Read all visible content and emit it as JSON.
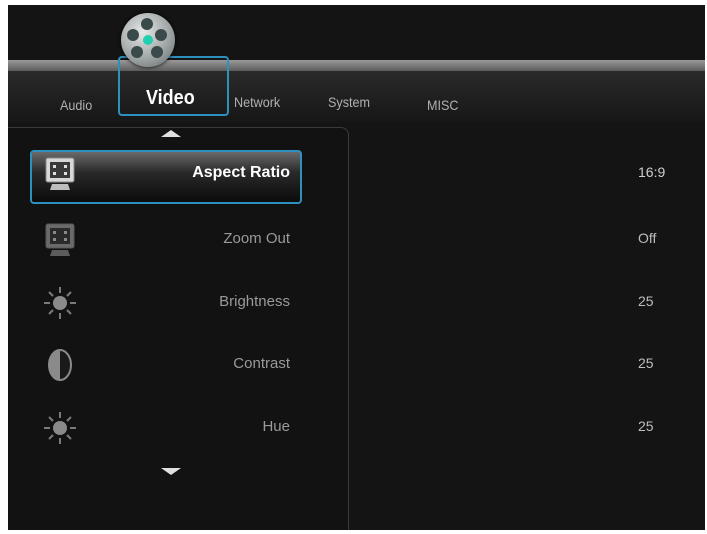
{
  "tabs": [
    {
      "label": "Audio",
      "active": false
    },
    {
      "label": "Video",
      "active": true
    },
    {
      "label": "Network",
      "active": false
    },
    {
      "label": "System",
      "active": false
    },
    {
      "label": "MISC",
      "active": false
    }
  ],
  "colors": {
    "accent": "#2f8fbf",
    "background": "#141414"
  },
  "menu": {
    "items": [
      {
        "label": "Aspect Ratio",
        "value": "16:9",
        "icon": "monitor-icon",
        "selected": true
      },
      {
        "label": "Zoom Out",
        "value": "Off",
        "icon": "monitor-icon",
        "selected": false
      },
      {
        "label": "Brightness",
        "value": "25",
        "icon": "sun-icon",
        "selected": false
      },
      {
        "label": "Contrast",
        "value": "25",
        "icon": "contrast-icon",
        "selected": false
      },
      {
        "label": "Hue",
        "value": "25",
        "icon": "sun-icon",
        "selected": false
      }
    ],
    "scroll_up_icon": "arrow-up-icon",
    "scroll_down_icon": "arrow-down-icon"
  },
  "category_icon": "film-reel-icon"
}
